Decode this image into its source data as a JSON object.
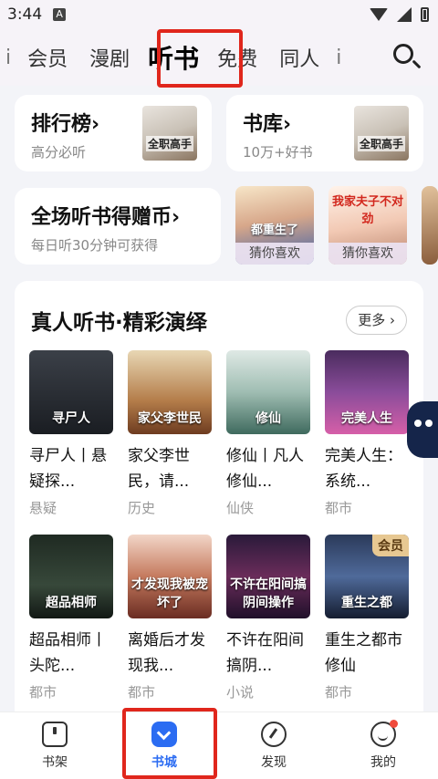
{
  "status_bar": {
    "time": "3:44",
    "notif_letter": "A"
  },
  "top_nav": {
    "tabs": [
      {
        "label": "i",
        "state": "partial"
      },
      {
        "label": "会员",
        "state": "normal"
      },
      {
        "label": "漫剧",
        "state": "normal"
      },
      {
        "label": "听书",
        "state": "active"
      },
      {
        "label": "免费",
        "state": "normal"
      },
      {
        "label": "同人",
        "state": "normal"
      },
      {
        "label": "i",
        "state": "partial"
      }
    ],
    "search_icon": "search-icon"
  },
  "entries": {
    "ranking": {
      "title": "排行榜",
      "arrow": "›",
      "subtitle": "高分必听",
      "thumb_text": "全职高手"
    },
    "library": {
      "title": "书库",
      "arrow": "›",
      "subtitle": "10万+好书",
      "thumb_text": "全职高手"
    }
  },
  "promo": {
    "title": "全场听书得赠币",
    "arrow": "›",
    "subtitle": "每日听30分钟可获得",
    "thumbs": [
      {
        "cover_text": "都重生了",
        "label": "猜你喜欢"
      },
      {
        "cover_text": "我家夫子不对劲",
        "label": "猜你喜欢"
      }
    ]
  },
  "section": {
    "title": "真人听书·精彩演绎",
    "more_label": "更多 ›",
    "books": [
      {
        "cover_text": "寻尸人",
        "title": "寻尸人丨悬疑探...",
        "category": "悬疑",
        "vip": ""
      },
      {
        "cover_text": "家父李世民",
        "title": "家父李世民，请...",
        "category": "历史",
        "vip": ""
      },
      {
        "cover_text": "修仙",
        "title": "修仙丨凡人修仙...",
        "category": "仙侠",
        "vip": ""
      },
      {
        "cover_text": "完美人生",
        "title": "完美人生：系统...",
        "category": "都市",
        "vip": ""
      },
      {
        "cover_text": "超品相师",
        "title": "超品相师丨头陀...",
        "category": "都市",
        "vip": ""
      },
      {
        "cover_text": "才发现我被宠坏了",
        "title": "离婚后才发现我...",
        "category": "都市",
        "vip": ""
      },
      {
        "cover_text": "不许在阳间搞阴间操作",
        "title": "不许在阳间搞阴...",
        "category": "小说",
        "vip": ""
      },
      {
        "cover_text": "重生之都",
        "title": "重生之都市修仙",
        "category": "都市",
        "vip": "会员"
      }
    ]
  },
  "bottom_nav": {
    "items": [
      {
        "label": "书架",
        "icon": "bookshelf-icon"
      },
      {
        "label": "书城",
        "icon": "bookstore-icon"
      },
      {
        "label": "发现",
        "icon": "discover-icon"
      },
      {
        "label": "我的",
        "icon": "profile-icon"
      }
    ]
  },
  "colors": {
    "accent": "#2b6cf2",
    "highlight": "#e0261c",
    "vip_badge": "#e7c892"
  }
}
